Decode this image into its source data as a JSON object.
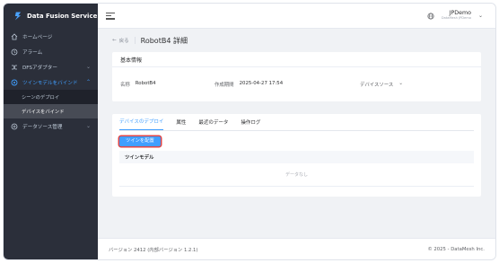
{
  "app": {
    "brand": "Data Fusion Service"
  },
  "sidebar": {
    "items": [
      {
        "label": "ホームページ",
        "icon": "home-icon"
      },
      {
        "label": "アラーム",
        "icon": "alarm-icon"
      },
      {
        "label": "DFSアダプター",
        "icon": "shuffle-icon",
        "has_children": true
      },
      {
        "label": "ツインモデルをバインド",
        "icon": "twin-model-icon",
        "has_children": true,
        "active": true
      },
      {
        "label": "データソース管理",
        "icon": "database-icon",
        "has_children": true
      }
    ],
    "submenu": [
      {
        "label": "シーンのデプロイ"
      },
      {
        "label": "デバイスをバインド",
        "selected": true
      }
    ]
  },
  "header": {
    "user_name": "JPDemo",
    "user_org": "DataMesh JPDemo",
    "language_icon": "globe-icon"
  },
  "page": {
    "back_label": "戻る",
    "title": "RobotB4 詳細"
  },
  "basic_info": {
    "title": "基本情報",
    "name_label": "名称",
    "name_value": "RobotB4",
    "created_label": "作成期間",
    "created_value": "2025-04-27 17:54",
    "device_source_label": "デバイスソース"
  },
  "tabs": [
    {
      "label": "デバイスのデプロイ",
      "active": true
    },
    {
      "label": "属性"
    },
    {
      "label": "最近のデータ"
    },
    {
      "label": "操作ログ"
    }
  ],
  "deploy": {
    "button_label": "ツインを配置",
    "table_header": "ツインモデル",
    "empty_text": "データなし"
  },
  "footer": {
    "version": "バージョン 2412 (内部バージョン 1.2.1)",
    "copyright": "© 2025 - DataMesh Inc."
  },
  "colors": {
    "accent": "#409eff",
    "sidebar_bg": "#2b2f3a",
    "highlight": "#e04444"
  }
}
